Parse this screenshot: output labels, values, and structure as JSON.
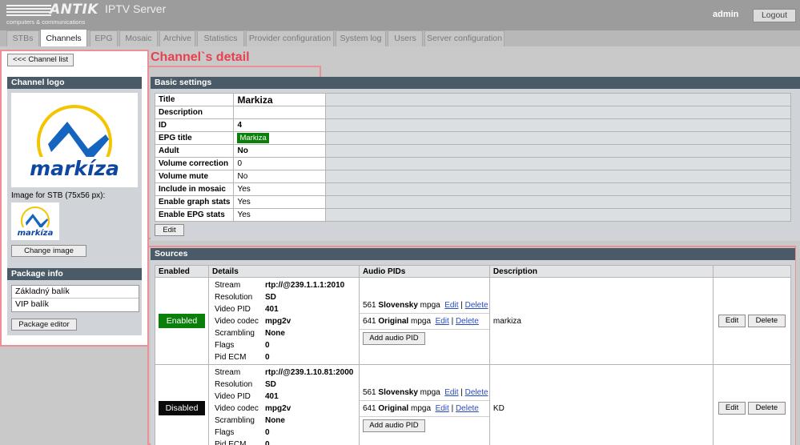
{
  "header": {
    "logo_word": "ANTIK",
    "logo_sub": "computers & communications",
    "app_title": "IPTV Server",
    "username": "admin",
    "logout_label": "Logout"
  },
  "tabs": [
    {
      "label": "STBs"
    },
    {
      "label": "Channels",
      "active": true
    },
    {
      "label": "EPG"
    },
    {
      "label": "Mosaic"
    },
    {
      "label": "Archive"
    },
    {
      "label": "Statistics"
    },
    {
      "label": "Provider configuration"
    },
    {
      "label": "System log"
    },
    {
      "label": "Users"
    },
    {
      "label": "Server configuration"
    }
  ],
  "annotation": {
    "label": "Channel`s detail"
  },
  "left": {
    "channel_list_button": "<<< Channel list",
    "logo_section_title": "Channel logo",
    "logo_text": "markíza",
    "stb_image_label": "Image for STB (75x56 px):",
    "change_image_button": "Change image",
    "package_section_title": "Package info",
    "packages": [
      "Základný balík",
      "VIP balík"
    ],
    "package_editor_button": "Package editor"
  },
  "basic": {
    "section_title": "Basic settings",
    "rows": [
      {
        "label": "Title",
        "value": "Markiza"
      },
      {
        "label": "Description",
        "value": ""
      },
      {
        "label": "ID",
        "value": "4"
      },
      {
        "label": "EPG title",
        "value": "Markiza"
      },
      {
        "label": "Adult",
        "value": "No"
      },
      {
        "label": "Volume correction",
        "value": "0"
      },
      {
        "label": "Volume mute",
        "value": "No"
      },
      {
        "label": "Include in mosaic",
        "value": "Yes"
      },
      {
        "label": "Enable graph stats",
        "value": "Yes"
      },
      {
        "label": "Enable EPG stats",
        "value": "Yes"
      }
    ],
    "edit_button": "Edit"
  },
  "sources": {
    "section_title": "Sources",
    "columns": [
      "Enabled",
      "Details",
      "Audio PIDs",
      "Description",
      ""
    ],
    "detail_labels": [
      "Stream",
      "Resolution",
      "Video PID",
      "Video codec",
      "Scrambling",
      "Flags",
      "Pid ECM"
    ],
    "link_edit": "Edit",
    "link_delete": "Delete",
    "add_audio_pid": "Add audio PID",
    "edit_button": "Edit",
    "delete_button": "Delete",
    "rows": [
      {
        "status": "Enabled",
        "status_color": "#0a7f0a",
        "stream": "rtp://@239.1.1.1:2010",
        "resolution": "SD",
        "video_pid": "401",
        "video_codec": "mpg2v",
        "scrambling": "None",
        "flags": "0",
        "pid_ecm": "0",
        "audio_pids": [
          {
            "pid": "561",
            "lang": "Slovensky",
            "codec": "mpga"
          },
          {
            "pid": "641",
            "lang": "Original",
            "codec": "mpga"
          }
        ],
        "description": "markiza"
      },
      {
        "status": "Disabled",
        "status_color": "#0a0a0a",
        "stream": "rtp://@239.1.10.81:2000",
        "resolution": "SD",
        "video_pid": "401",
        "video_codec": "mpg2v",
        "scrambling": "None",
        "flags": "0",
        "pid_ecm": "0",
        "audio_pids": [
          {
            "pid": "561",
            "lang": "Slovensky",
            "codec": "mpga"
          },
          {
            "pid": "641",
            "lang": "Original",
            "codec": "mpga"
          }
        ],
        "description": "KD"
      }
    ]
  }
}
